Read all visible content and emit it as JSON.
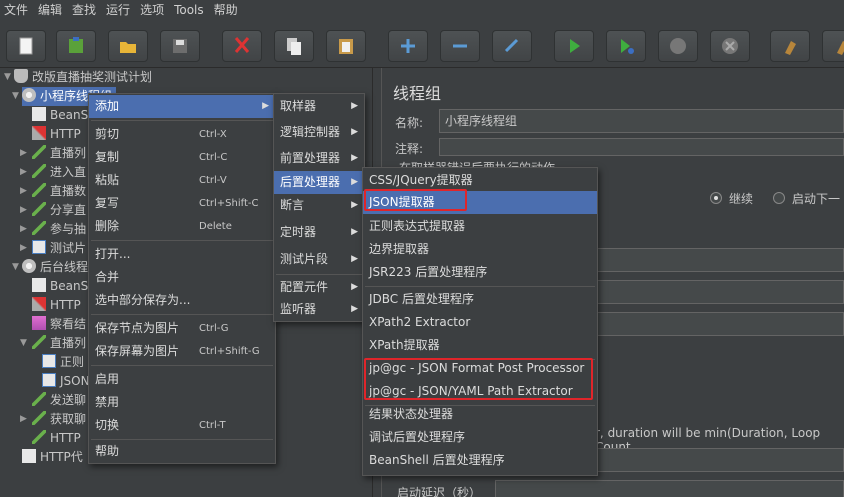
{
  "menubar": [
    "文件",
    "编辑",
    "查找",
    "运行",
    "选项",
    "Tools",
    "帮助"
  ],
  "toolbar": [
    "new-icon",
    "templates-icon",
    "open-icon",
    "save-icon",
    "cut-icon",
    "copy-icon",
    "paste-icon",
    "expand-icon",
    "collapse-icon",
    "toggle-icon",
    "start-icon",
    "start-no-pause-icon",
    "stop-icon",
    "shutdown-icon",
    "clear-icon",
    "clear-all-icon"
  ],
  "tree": {
    "root": "改版直播抽奖测试计划",
    "group1": "小程序线程组",
    "items1": [
      "BeanS",
      "HTTP",
      "直播列",
      "进入直",
      "直播数",
      "分享直",
      "参与抽",
      "测试片"
    ],
    "group2": "后台线程",
    "items2": [
      "BeanS",
      "HTTP",
      "察看结",
      "直播列",
      "正则",
      "JSON",
      "发送聊",
      "获取聊",
      "HTTP"
    ],
    "last": "HTTP代"
  },
  "right": {
    "title": "线程组",
    "name_label": "名称:",
    "name_value": "小程序线程组",
    "comment_label": "注释:",
    "action_label": "在取样器错误后要执行的动作",
    "radio_continue": "继续",
    "radio_next": "启动下一",
    "duration_text": "r, duration will be min(Duration, Loop Count",
    "startup_delay": "启动延迟（秒）"
  },
  "menu1": {
    "items": [
      {
        "label": "添加",
        "shortcut": ""
      },
      {
        "label": "剪切",
        "shortcut": "Ctrl-X"
      },
      {
        "label": "复制",
        "shortcut": "Ctrl-C"
      },
      {
        "label": "粘贴",
        "shortcut": "Ctrl-V"
      },
      {
        "label": "复写",
        "shortcut": "Ctrl+Shift-C"
      },
      {
        "label": "删除",
        "shortcut": "Delete"
      },
      {
        "label": "打开...",
        "shortcut": ""
      },
      {
        "label": "合并",
        "shortcut": ""
      },
      {
        "label": "选中部分保存为...",
        "shortcut": ""
      },
      {
        "label": "保存节点为图片",
        "shortcut": "Ctrl-G"
      },
      {
        "label": "保存屏幕为图片",
        "shortcut": "Ctrl+Shift-G"
      },
      {
        "label": "启用",
        "shortcut": ""
      },
      {
        "label": "禁用",
        "shortcut": ""
      },
      {
        "label": "切换",
        "shortcut": "Ctrl-T"
      },
      {
        "label": "帮助",
        "shortcut": ""
      }
    ]
  },
  "menu2": {
    "items": [
      "取样器",
      "逻辑控制器",
      "前置处理器",
      "后置处理器",
      "断言",
      "定时器",
      "测试片段",
      "配置元件",
      "监听器"
    ]
  },
  "menu3": {
    "items": [
      "CSS/JQuery提取器",
      "JSON提取器",
      "正则表达式提取器",
      "边界提取器",
      "JSR223 后置处理程序",
      "JDBC 后置处理程序",
      "XPath2 Extractor",
      "XPath提取器",
      "jp@gc - JSON Format Post Processor",
      "jp@gc - JSON/YAML Path Extractor",
      "结果状态处理器",
      "调试后置处理程序",
      "BeanShell 后置处理程序"
    ]
  }
}
